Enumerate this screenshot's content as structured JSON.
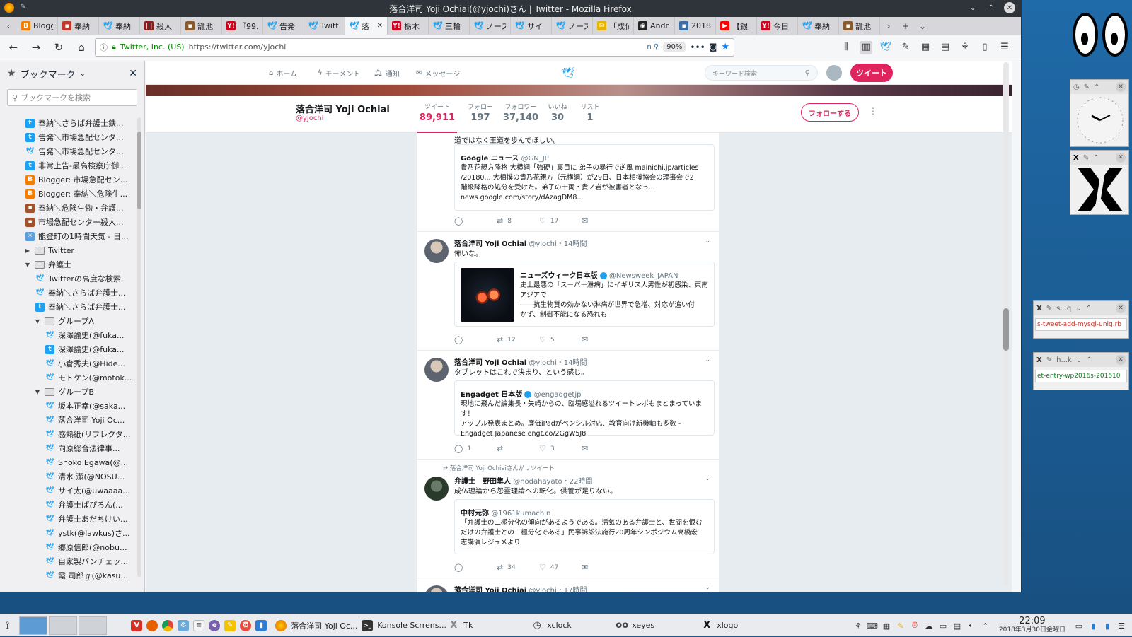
{
  "window": {
    "title": "落合洋司 Yoji Ochiai(@yjochi)さん | Twitter - Mozilla Firefox"
  },
  "tabs": [
    {
      "label": "Blogg",
      "icon": "blogger-icon",
      "color": "#f57d00"
    },
    {
      "label": "奉納",
      "icon": "site-icon",
      "color": "#c0392b"
    },
    {
      "label": "奉納",
      "icon": "twitter-icon",
      "color": "#1da1f2"
    },
    {
      "label": "殺人",
      "icon": "bars-icon",
      "color": "#8e1b1b"
    },
    {
      "label": "籠池",
      "icon": "site-icon",
      "color": "#8b5a2b"
    },
    {
      "label": "『99.",
      "icon": "yahoo-icon",
      "color": "#d0021b"
    },
    {
      "label": "告発",
      "icon": "twitter-icon",
      "color": "#1da1f2"
    },
    {
      "label": "Twitt",
      "icon": "twitter-icon",
      "color": "#1da1f2"
    },
    {
      "label": "落",
      "icon": "twitter-icon",
      "color": "#1da1f2",
      "active": true
    },
    {
      "label": "栃木",
      "icon": "yahoo-icon",
      "color": "#d0021b"
    },
    {
      "label": "三輪",
      "icon": "twitter-icon",
      "color": "#1da1f2"
    },
    {
      "label": "ノース",
      "icon": "twitter-icon",
      "color": "#1da1f2"
    },
    {
      "label": "サイ",
      "icon": "twitter-icon",
      "color": "#1da1f2"
    },
    {
      "label": "ノース",
      "icon": "twitter-icon",
      "color": "#1da1f2"
    },
    {
      "label": "「成仏",
      "icon": "note-icon",
      "color": "#e6b400"
    },
    {
      "label": "Andr",
      "icon": "github-icon",
      "color": "#222222"
    },
    {
      "label": "2018",
      "icon": "site-icon",
      "color": "#3a6ea5"
    },
    {
      "label": "【銀",
      "icon": "youtube-icon",
      "color": "#ff0000"
    },
    {
      "label": "今日",
      "icon": "yahoo-icon",
      "color": "#d0021b"
    },
    {
      "label": "奉納",
      "icon": "twitter-icon",
      "color": "#1da1f2"
    },
    {
      "label": "籠池",
      "icon": "site-icon",
      "color": "#8b5a2b"
    }
  ],
  "urlbar": {
    "site": "Twitter, Inc. (US)",
    "url": "https://twitter.com/yjochi",
    "zoom": "90%"
  },
  "sidebar": {
    "title": "ブックマーク",
    "search_placeholder": "ブックマークを検索",
    "items": [
      {
        "label": "奉納＼さらば弁護士鉄...",
        "icon": "tweetdeck-icon",
        "indent": 1
      },
      {
        "label": "告発＼市場急配センタ...",
        "icon": "tweetdeck-icon",
        "indent": 1
      },
      {
        "label": "告発＼市場急配センタ...",
        "icon": "twitter-icon",
        "indent": 1
      },
      {
        "label": "非常上告-最高検察庁御...",
        "icon": "tweetdeck-icon",
        "indent": 1
      },
      {
        "label": "Blogger: 市場急配セン...",
        "icon": "blogger-icon",
        "indent": 1
      },
      {
        "label": "Blogger: 奉納＼危険生...",
        "icon": "blogger-icon",
        "indent": 1
      },
      {
        "label": "奉納＼危険生物・弁護...",
        "icon": "site-icon",
        "indent": 1
      },
      {
        "label": "市場急配センター殺人...",
        "icon": "site-icon",
        "indent": 1
      },
      {
        "label": "能登町の1時間天気 - 日...",
        "icon": "weather-icon",
        "indent": 1
      },
      {
        "label": "Twitter",
        "icon": "folder",
        "indent": 1,
        "arrow": "▶"
      },
      {
        "label": "弁護士",
        "icon": "folder",
        "indent": 1,
        "arrow": "▼"
      },
      {
        "label": "Twitterの高度な検索",
        "icon": "twitter-icon",
        "indent": 2
      },
      {
        "label": "奉納＼さらば弁護士...",
        "icon": "twitter-icon",
        "indent": 2
      },
      {
        "label": "奉納＼さらば弁護士...",
        "icon": "tweetdeck-icon",
        "indent": 2
      },
      {
        "label": "グループA",
        "icon": "folder",
        "indent": 2,
        "arrow": "▼"
      },
      {
        "label": "深澤諭史(@fuka...",
        "icon": "twitter-icon",
        "indent": 3
      },
      {
        "label": "深澤諭史(@fuka...",
        "icon": "tweetdeck-icon",
        "indent": 3
      },
      {
        "label": "小倉秀夫(@Hide...",
        "icon": "twitter-icon",
        "indent": 3
      },
      {
        "label": "モトケン(@motok...",
        "icon": "twitter-icon",
        "indent": 3
      },
      {
        "label": "グループB",
        "icon": "folder",
        "indent": 2,
        "arrow": "▼"
      },
      {
        "label": "坂本正幸(@saka...",
        "icon": "twitter-icon",
        "indent": 3
      },
      {
        "label": "落合洋司 Yoji Oc...",
        "icon": "twitter-icon",
        "indent": 3
      },
      {
        "label": "感熱紙(リフレクタ...",
        "icon": "twitter-icon",
        "indent": 3
      },
      {
        "label": "向原総合法律事...",
        "icon": "twitter-icon",
        "indent": 3
      },
      {
        "label": "Shoko Egawa(@...",
        "icon": "twitter-icon",
        "indent": 3
      },
      {
        "label": "清水 潔(@NOSU...",
        "icon": "twitter-icon",
        "indent": 3
      },
      {
        "label": "サイ太(@uwaaaa...",
        "icon": "twitter-icon",
        "indent": 3
      },
      {
        "label": "弁護士ぱぴろん(...",
        "icon": "twitter-icon",
        "indent": 3
      },
      {
        "label": "弁護士あだちけい...",
        "icon": "twitter-icon",
        "indent": 3
      },
      {
        "label": "ystk(@lawkus)さ...",
        "icon": "twitter-icon",
        "indent": 3
      },
      {
        "label": "郷原信郎(@nobu...",
        "icon": "twitter-icon",
        "indent": 3
      },
      {
        "label": "自家製パンチェッ...",
        "icon": "twitter-icon",
        "indent": 3
      },
      {
        "label": "霞 司郎ℊ(@kasu...",
        "icon": "twitter-icon",
        "indent": 3
      }
    ]
  },
  "twitter": {
    "nav": {
      "home": "ホーム",
      "moments": "モーメント",
      "notifications": "通知",
      "messages": "メッセージ",
      "search_placeholder": "キーワード検索",
      "tweet_button": "ツイート"
    },
    "profile": {
      "name": "落合洋司 Yoji Ochiai",
      "handle": "@yjochi",
      "follow_button": "フォローする"
    },
    "stats": [
      {
        "label": "ツイート",
        "value": "89,911",
        "active": true
      },
      {
        "label": "フォロー",
        "value": "197"
      },
      {
        "label": "フォロワー",
        "value": "37,140"
      },
      {
        "label": "いいね",
        "value": "30"
      },
      {
        "label": "リスト",
        "value": "1"
      }
    ],
    "tweets": [
      {
        "partial_text": "道ではなく王道を歩んでほしい。",
        "card": {
          "name": "Google ニュース",
          "handle": "@GN_JP",
          "lines": [
            "貴乃花親方降格 大横綱「強硬」裏目に 弟子の暴行で逆風 mainichi.jp/articles",
            "/20180... 大相撲の貴乃花親方（元横綱）が29日、日本相撲協会の理事会で2",
            "階級降格の処分を受けた。弟子の十両・貴ノ岩が被害者となっ...",
            "news.google.com/story/dAzagDM8..."
          ]
        },
        "retweets": "8",
        "likes": "17"
      },
      {
        "name": "落合洋司 Yoji Ochiai",
        "handle": "@yjochi",
        "time": "・14時間",
        "text": "怖いな。",
        "card": {
          "name": "ニューズウィーク日本版",
          "handle": "@Newsweek_JAPAN",
          "lines": [
            "史上最悪の「スーパー淋病」にイギリス人男性が初感染、東南",
            "アジアで",
            "――抗生物質の効かない淋病が世界で急増、対応が追い付",
            "かず、制御不能になる恐れも"
          ]
        },
        "retweets": "12",
        "likes": "5"
      },
      {
        "name": "落合洋司 Yoji Ochiai",
        "handle": "@yjochi",
        "time": "・14時間",
        "text": "タブレットはこれで決まり、という感じ。",
        "card": {
          "name": "Engadget 日本版",
          "handle": "@engadgetjp",
          "lines": [
            "現地に飛んだ編集長・矢崎からの、臨場感溢れるツイートレポもまとまっています！",
            "アップル発表まとめ。廉価iPadがペンシル対応、教育向け新機軸も多数 -",
            "Engadget Japanese engt.co/2GgW5J8"
          ]
        },
        "replies": "1",
        "likes": "3"
      },
      {
        "retweet_label": "落合洋司 Yoji Ochiaiさんがリツイート",
        "name": "弁護士　野田隼人",
        "handle": "@nodahayato",
        "time": "・22時間",
        "text": "成仏理論から怨霊理論への転化。供養が足りない。",
        "card": {
          "name": "中村元弥",
          "handle": "@1961kumachin",
          "lines": [
            "「弁護士の二極分化の傾向があるようである。活気のある弁護士と、世間を恨む",
            "だけの弁護士との二極分化である」民事訴訟法施行20周年シンポジウム高橋宏",
            "志講演レジュメより"
          ]
        },
        "retweets": "34",
        "likes": "47"
      },
      {
        "name": "落合洋司 Yoji Ochiai",
        "handle": "@yjochi",
        "time": "・17時間"
      }
    ]
  },
  "desktop": {
    "tk1": {
      "label": "s...q",
      "text": "s-tweet-add-mysql-uniq.rb"
    },
    "tk2": {
      "label": "h...k",
      "text": "et-entry-wp2016s-201610"
    }
  },
  "taskbar": {
    "apps": [
      {
        "label": "落合洋司 Yoji Oc...",
        "icon": "firefox-icon",
        "color": "#e66000"
      },
      {
        "label": "Konsole Scrrens...",
        "icon": "konsole-icon",
        "color": "#333333"
      },
      {
        "label": "Tk",
        "icon": "tk-icon",
        "color": "#888888"
      },
      {
        "label": "xclock",
        "icon": "clock-icon",
        "color": "#444444"
      },
      {
        "label": "xeyes",
        "icon": "eyes-icon",
        "color": "#444444"
      },
      {
        "label": "xlogo",
        "icon": "x-icon",
        "color": "#111111"
      }
    ],
    "time": "22:09",
    "date": "2018年3月30日金曜日"
  }
}
